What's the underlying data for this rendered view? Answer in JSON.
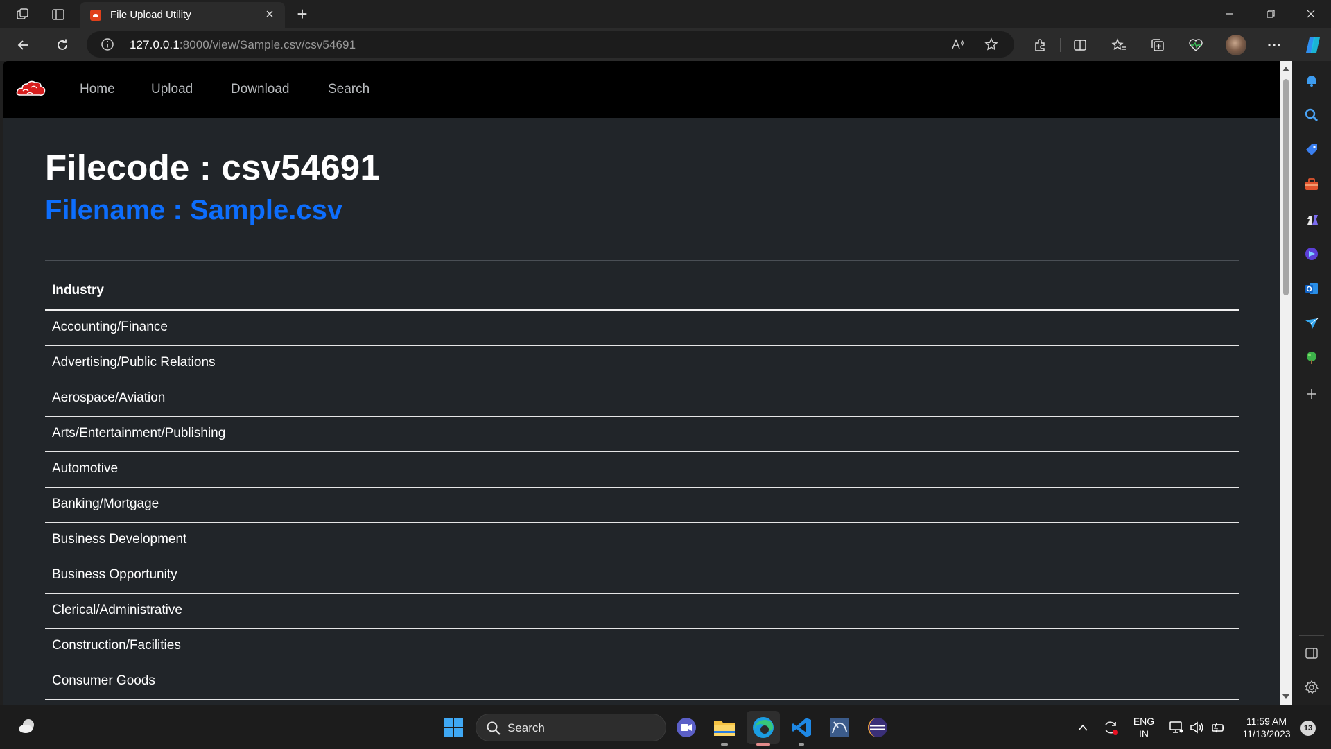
{
  "browser": {
    "tab_title": "File Upload Utility",
    "url_host": "127.0.0.1",
    "url_rest": ":8000/view/Sample.csv/csv54691"
  },
  "navbar": {
    "links": [
      "Home",
      "Upload",
      "Download",
      "Search"
    ]
  },
  "content": {
    "title": "Filecode : csv54691",
    "subtitle": "Filename : Sample.csv",
    "table": {
      "header": "Industry",
      "rows": [
        "Accounting/Finance",
        "Advertising/Public Relations",
        "Aerospace/Aviation",
        "Arts/Entertainment/Publishing",
        "Automotive",
        "Banking/Mortgage",
        "Business Development",
        "Business Opportunity",
        "Clerical/Administrative",
        "Construction/Facilities",
        "Consumer Goods"
      ]
    }
  },
  "taskbar": {
    "search_label": "Search",
    "lang_line1": "ENG",
    "lang_line2": "IN",
    "time": "11:59 AM",
    "date": "11/13/2023",
    "notification_count": "13"
  },
  "colors": {
    "accent_blue": "#0d6efd",
    "navbar_bg": "#000000",
    "page_bg": "#212529",
    "logo_red": "#d81e1e"
  },
  "icons": {
    "sidebar": [
      "bell-icon",
      "search-icon",
      "tag-icon",
      "toolbox-icon",
      "chess-icon",
      "copilot-designer-icon",
      "outlook-icon",
      "send-icon",
      "tree-icon",
      "add-icon",
      "sidebar-toggle-icon",
      "settings-icon"
    ]
  }
}
